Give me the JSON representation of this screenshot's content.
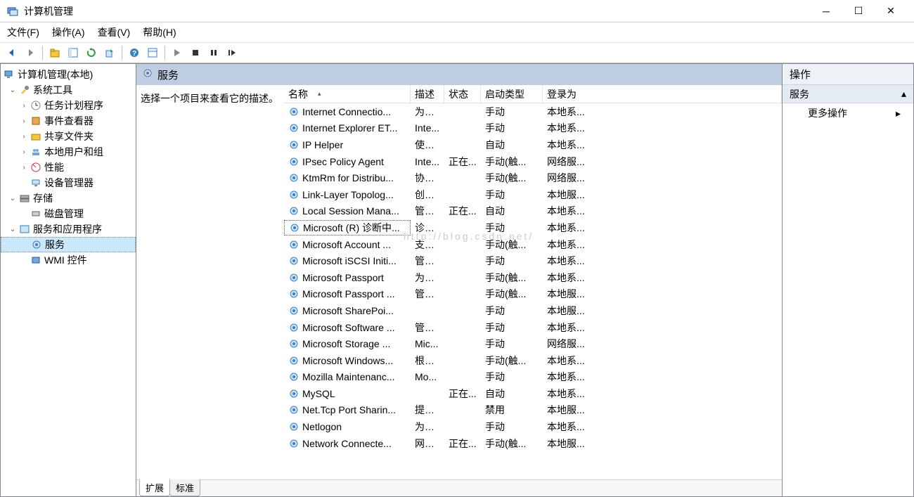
{
  "window": {
    "title": "计算机管理"
  },
  "menubar": {
    "file": "文件(F)",
    "action": "操作(A)",
    "view": "查看(V)",
    "help": "帮助(H)"
  },
  "tree": {
    "root": "计算机管理(本地)",
    "sysTools": "系统工具",
    "taskScheduler": "任务计划程序",
    "eventViewer": "事件查看器",
    "sharedFolders": "共享文件夹",
    "localUsers": "本地用户和组",
    "performance": "性能",
    "deviceMgr": "设备管理器",
    "storage": "存储",
    "diskMgmt": "磁盘管理",
    "servicesApps": "服务和应用程序",
    "services": "服务",
    "wmi": "WMI 控件"
  },
  "center": {
    "title": "服务",
    "desc": "选择一个项目来查看它的描述。",
    "columns": {
      "name": "名称",
      "desc": "描述",
      "status": "状态",
      "startup": "启动类型",
      "logon": "登录为"
    },
    "tabs": {
      "extended": "扩展",
      "standard": "标准"
    }
  },
  "colwidths": {
    "name": 180,
    "desc": 48,
    "status": 52,
    "startup": 88,
    "logon": 70
  },
  "services": [
    {
      "name": "Internet Connectio...",
      "desc": "为家...",
      "status": "",
      "startup": "手动",
      "logon": "本地系..."
    },
    {
      "name": "Internet Explorer ET...",
      "desc": "Inte...",
      "status": "",
      "startup": "手动",
      "logon": "本地系..."
    },
    {
      "name": "IP Helper",
      "desc": "使用...",
      "status": "",
      "startup": "自动",
      "logon": "本地系..."
    },
    {
      "name": "IPsec Policy Agent",
      "desc": "Inte...",
      "status": "正在...",
      "startup": "手动(触...",
      "logon": "网络服..."
    },
    {
      "name": "KtmRm for Distribu...",
      "desc": "协调...",
      "status": "",
      "startup": "手动(触...",
      "logon": "网络服..."
    },
    {
      "name": "Link-Layer Topolog...",
      "desc": "创建...",
      "status": "",
      "startup": "手动",
      "logon": "本地服..."
    },
    {
      "name": "Local Session Mana...",
      "desc": "管理...",
      "status": "正在...",
      "startup": "自动",
      "logon": "本地系..."
    },
    {
      "name": "Microsoft (R) 诊断中...",
      "desc": "诊断...",
      "status": "",
      "startup": "手动",
      "logon": "本地系...",
      "selected": true
    },
    {
      "name": "Microsoft Account ...",
      "desc": "支持...",
      "status": "",
      "startup": "手动(触...",
      "logon": "本地系..."
    },
    {
      "name": "Microsoft iSCSI Initi...",
      "desc": "管理...",
      "status": "",
      "startup": "手动",
      "logon": "本地系..."
    },
    {
      "name": "Microsoft Passport",
      "desc": "为用...",
      "status": "",
      "startup": "手动(触...",
      "logon": "本地系..."
    },
    {
      "name": "Microsoft Passport ...",
      "desc": "管理...",
      "status": "",
      "startup": "手动(触...",
      "logon": "本地服..."
    },
    {
      "name": "Microsoft SharePoi...",
      "desc": "",
      "status": "",
      "startup": "手动",
      "logon": "本地服..."
    },
    {
      "name": "Microsoft Software ...",
      "desc": "管理...",
      "status": "",
      "startup": "手动",
      "logon": "本地系..."
    },
    {
      "name": "Microsoft Storage ...",
      "desc": "Mic...",
      "status": "",
      "startup": "手动",
      "logon": "网络服..."
    },
    {
      "name": "Microsoft Windows...",
      "desc": "根据...",
      "status": "",
      "startup": "手动(触...",
      "logon": "本地系..."
    },
    {
      "name": "Mozilla Maintenanc...",
      "desc": "Mo...",
      "status": "",
      "startup": "手动",
      "logon": "本地系..."
    },
    {
      "name": "MySQL",
      "desc": "",
      "status": "正在...",
      "startup": "自动",
      "logon": "本地系..."
    },
    {
      "name": "Net.Tcp Port Sharin...",
      "desc": "提供...",
      "status": "",
      "startup": "禁用",
      "logon": "本地服..."
    },
    {
      "name": "Netlogon",
      "desc": "为用...",
      "status": "",
      "startup": "手动",
      "logon": "本地系..."
    },
    {
      "name": "Network Connecte...",
      "desc": "网络...",
      "status": "正在...",
      "startup": "手动(触...",
      "logon": "本地服..."
    }
  ],
  "actions": {
    "title": "操作",
    "band": "服务",
    "more": "更多操作"
  },
  "watermark": "http://blog.csdn.net/"
}
